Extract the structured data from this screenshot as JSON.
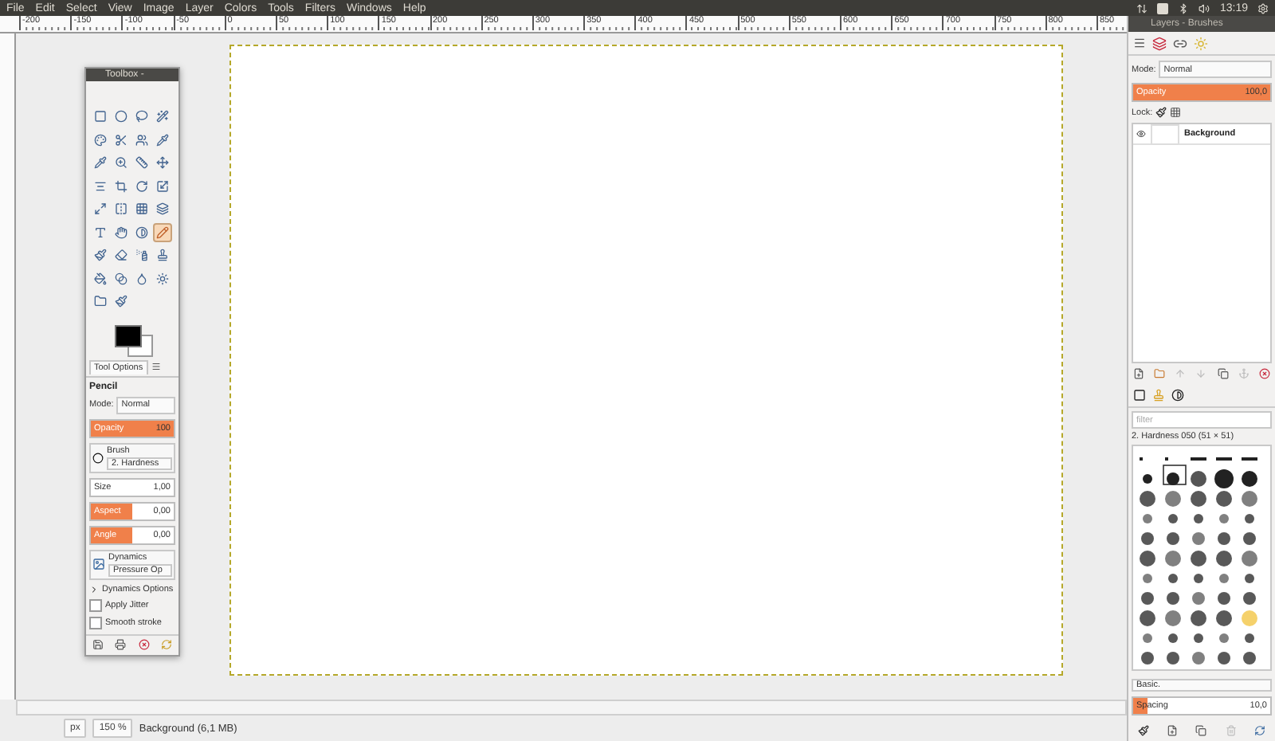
{
  "menu_bar": {
    "items": [
      "File",
      "Edit",
      "Select",
      "View",
      "Image",
      "Layer",
      "Colors",
      "Tools",
      "Filters",
      "Windows",
      "Help"
    ],
    "clock": "13:19"
  },
  "ruler": {
    "labels": [
      "-200",
      "-150",
      "-100",
      "-50",
      "0",
      "50",
      "100",
      "150",
      "200",
      "250",
      "300",
      "350",
      "400",
      "450",
      "500",
      "550",
      "600",
      "650",
      "700",
      "750",
      "800",
      "850"
    ]
  },
  "toolbox": {
    "title": "Toolbox - ",
    "tools": [
      {
        "selected": false
      },
      {
        "selected": false
      },
      {
        "selected": false
      },
      {
        "selected": false
      },
      {
        "selected": false
      },
      {
        "selected": false
      },
      {
        "selected": false
      },
      {
        "selected": false
      },
      {
        "selected": false
      },
      {
        "selected": false
      },
      {
        "selected": false
      },
      {
        "selected": false
      },
      {
        "selected": false
      },
      {
        "selected": false
      },
      {
        "selected": false
      },
      {
        "selected": false
      },
      {
        "selected": false
      },
      {
        "selected": false
      },
      {
        "selected": false
      },
      {
        "selected": false
      },
      {
        "selected": false
      },
      {
        "selected": false
      },
      {
        "selected": false
      },
      {
        "selected": true
      },
      {
        "selected": false
      },
      {
        "selected": false
      },
      {
        "selected": false
      },
      {
        "selected": false
      },
      {
        "selected": false
      },
      {
        "selected": false
      },
      {
        "selected": false
      },
      {
        "selected": false
      },
      {
        "selected": false
      },
      {
        "selected": false
      }
    ],
    "tool_options": {
      "tab": "Tool Options",
      "tool": "Pencil",
      "mode_label": "Mode:",
      "mode": "Normal",
      "opacity": {
        "label": "Opacity",
        "value": "100",
        "level": 1
      },
      "brush_label": "Brush",
      "brush": "2. Hardness",
      "size": {
        "label": "Size",
        "value": "1,00"
      },
      "aspect": {
        "label": "Aspect",
        "value": "0,00",
        "level": 0.5
      },
      "angle": {
        "label": "Angle",
        "value": "0,00",
        "level": 0.5
      },
      "dynamics_label": "Dynamics",
      "dynamics": "Pressure Op",
      "dynamics_options": {
        "label": "Dynamics Options",
        "expanded": false
      },
      "checkboxes": [
        {
          "label": "Apply Jitter",
          "checked": false
        },
        {
          "label": "Smooth stroke",
          "checked": false
        }
      ]
    }
  },
  "layers_dock": {
    "title": "Layers - Brushes",
    "mode_label": "Mode:",
    "mode": "Normal",
    "opacity": {
      "label": "Opacity",
      "value": "100,0",
      "level": 1
    },
    "lock_label": "Lock:",
    "layers": [
      {
        "name": "Background",
        "visible": true
      }
    ]
  },
  "brushes": {
    "filter_placeholder": "filter",
    "brush_name": "2. Hardness 050 (51 × 51)",
    "preset": "Basic.",
    "spacing": {
      "label": "Spacing",
      "value": "10,0",
      "level": 0.1
    }
  },
  "status_bar": {
    "unit": "px",
    "zoom": "150 %",
    "info": "Background (6,1 MB)"
  }
}
